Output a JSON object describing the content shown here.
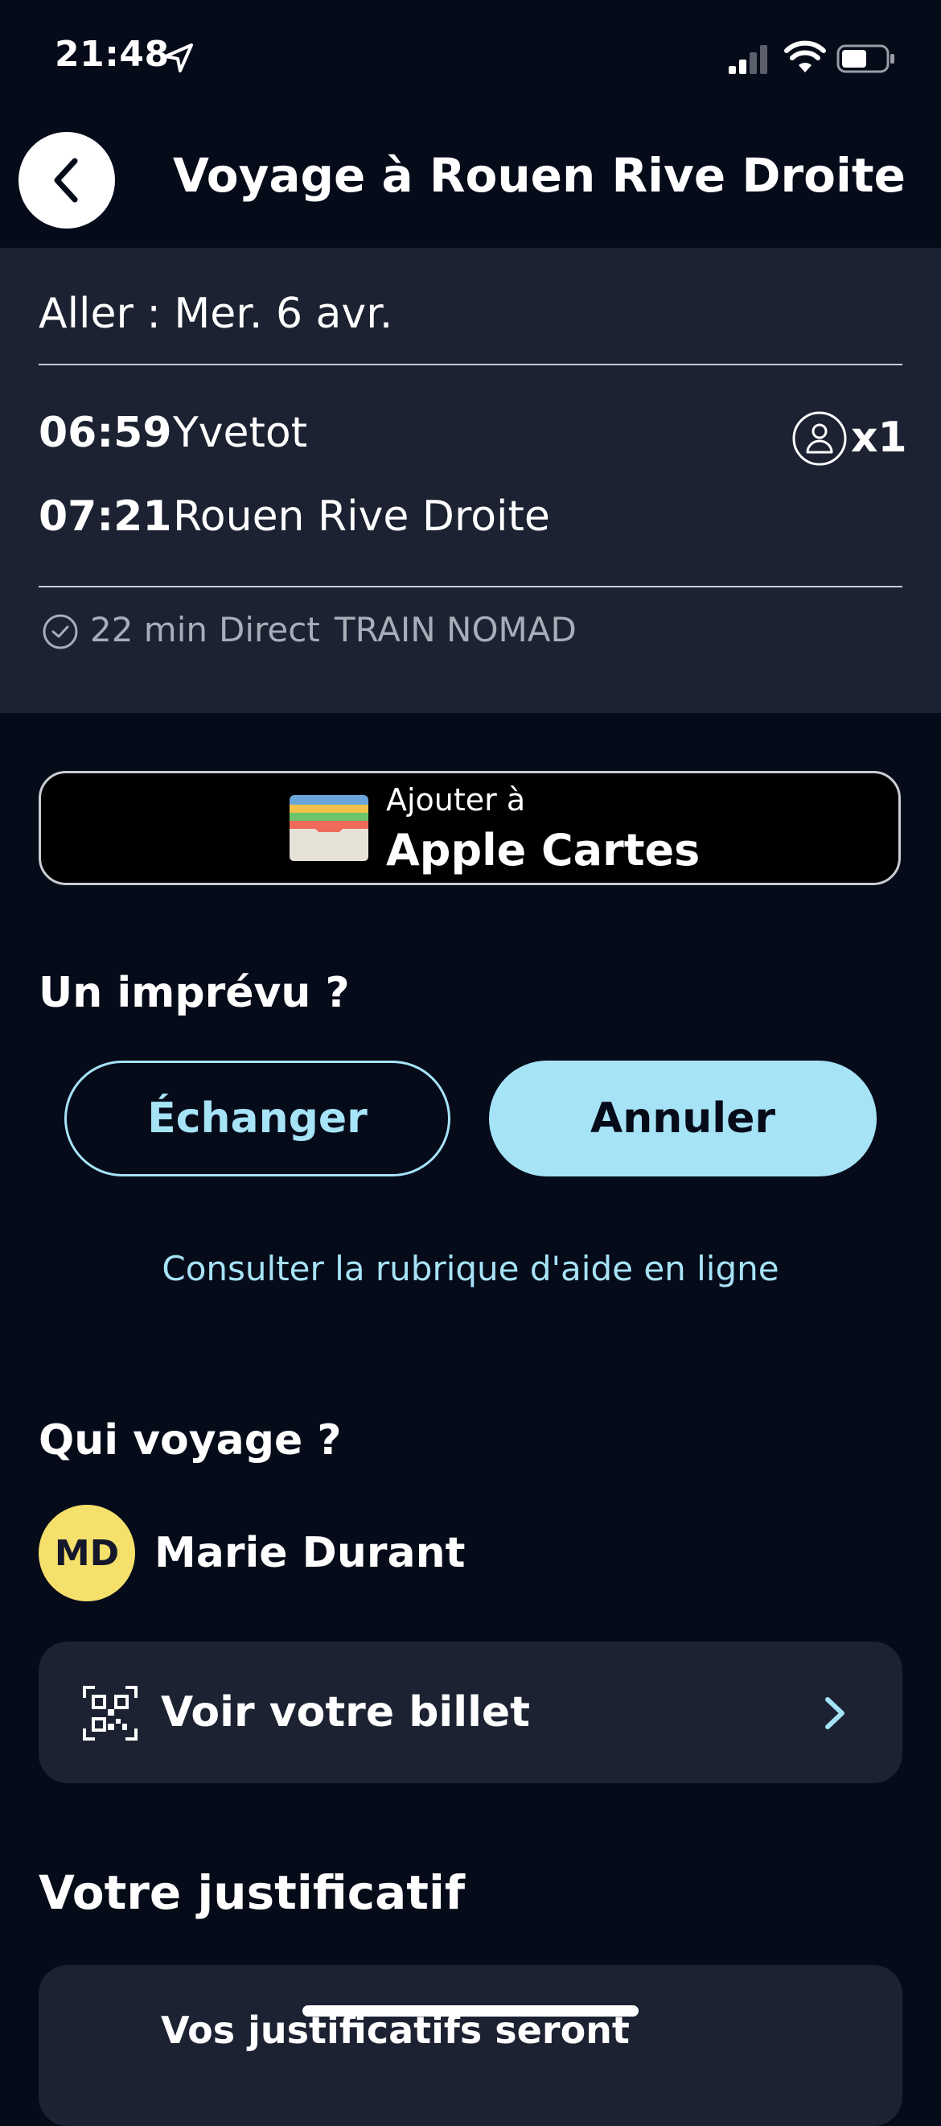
{
  "status_bar": {
    "time": "21:48",
    "icons": [
      "location-arrow-icon",
      "signal-icon",
      "wifi-icon",
      "battery-icon"
    ]
  },
  "header": {
    "back_icon": "chevron-left-icon",
    "title": "Voyage à Rouen Rive Droite"
  },
  "trip": {
    "date": "Aller : Mer. 6 avr.",
    "departure": {
      "time": "06:59",
      "station": "Yvetot"
    },
    "arrival": {
      "time": "07:21",
      "station": "Rouen Rive Droite"
    },
    "passengers": "x1",
    "duration": "22 min",
    "type": "Direct",
    "train": "TRAIN NOMAD"
  },
  "wallet": {
    "small_label": "Ajouter à",
    "big_label": "Apple Cartes"
  },
  "unexpected": {
    "title": "Un imprévu ?",
    "exchange_label": "Échanger",
    "cancel_label": "Annuler",
    "help_link": "Consulter la rubrique d'aide en ligne"
  },
  "travellers": {
    "title": "Qui voyage ?",
    "initials": "MD",
    "name": "Marie Durant",
    "ticket_label": "Voir votre billet"
  },
  "receipt": {
    "title": "Votre justificatif",
    "text": "Vos justificatifs seront"
  },
  "colors": {
    "background": "#060b19",
    "card": "#1c2231",
    "accent": "#a6e3f7",
    "avatar": "#f4e06b"
  }
}
